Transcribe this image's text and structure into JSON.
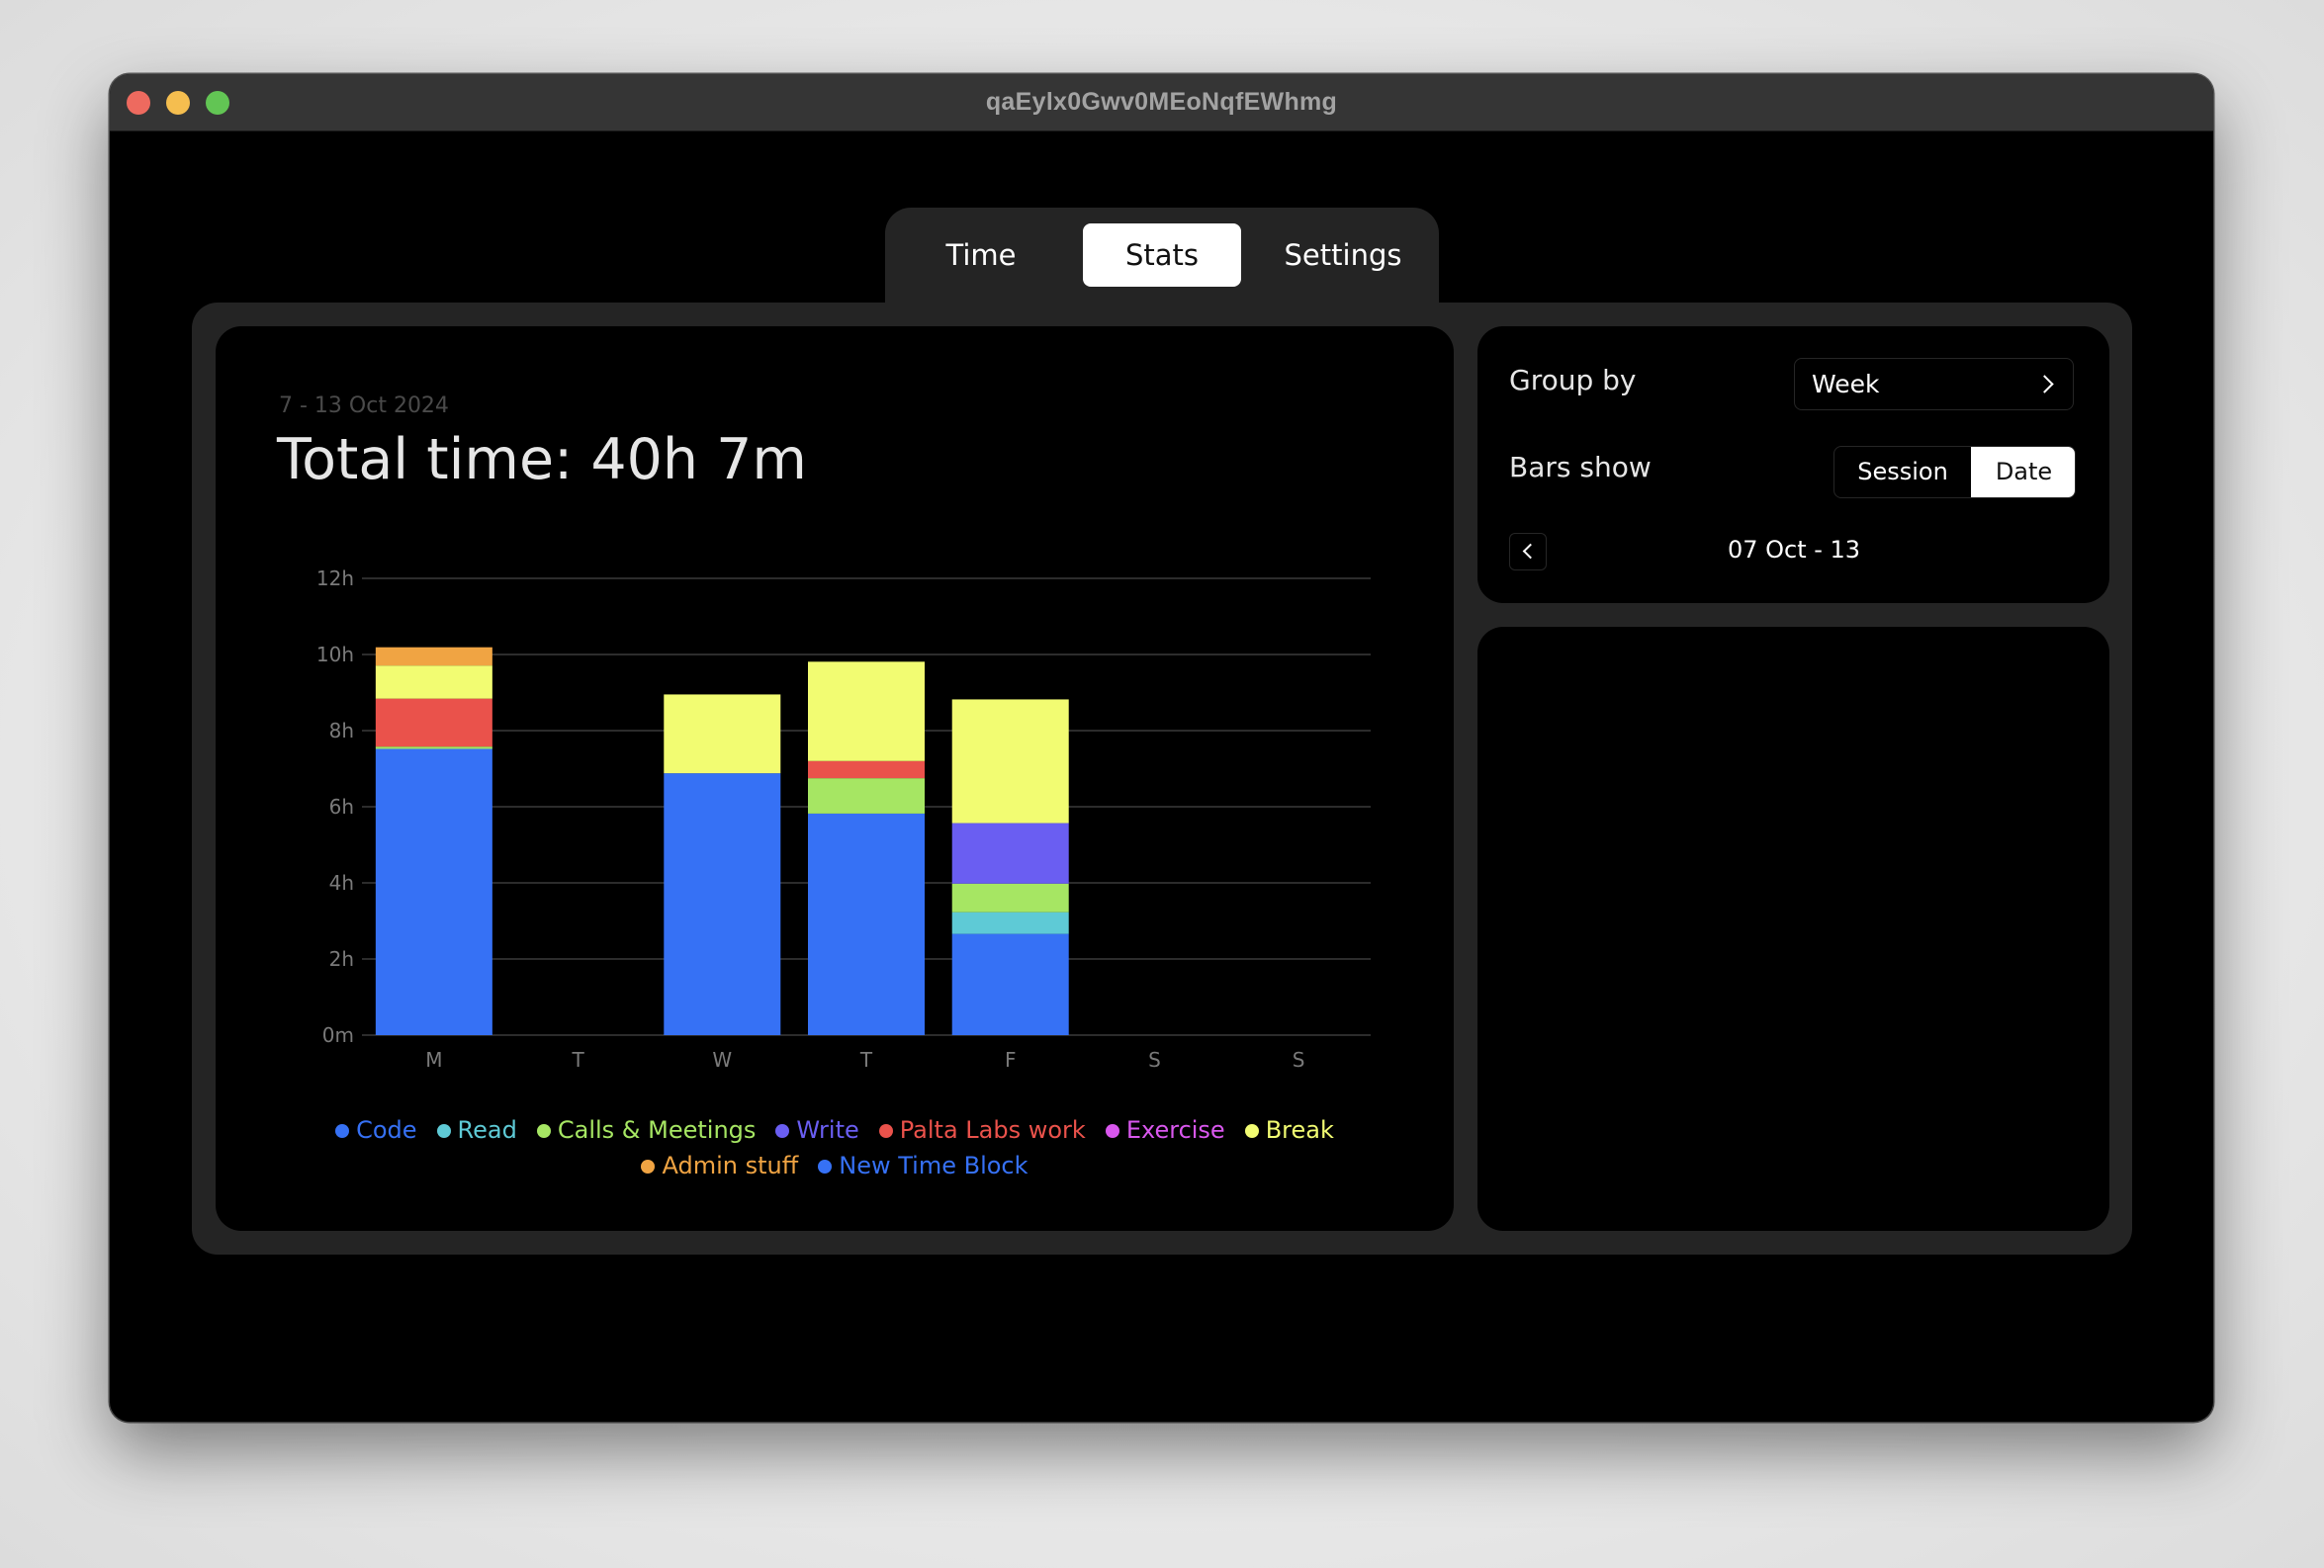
{
  "window": {
    "title": "qaEylx0Gwv0MEoNqfEWhmg",
    "controls": [
      "close",
      "minimize",
      "zoom"
    ]
  },
  "tabs": [
    {
      "label": "Time",
      "active": false
    },
    {
      "label": "Stats",
      "active": true
    },
    {
      "label": "Settings",
      "active": false
    }
  ],
  "summary": {
    "range_label": "7 - 13 Oct 2024",
    "total_label": "Total time: 40h 7m"
  },
  "controls": {
    "group_by_label": "Group by",
    "group_by_value": "Week",
    "bars_show_label": "Bars show",
    "bars_show_options": [
      "Session",
      "Date"
    ],
    "bars_show_selected": "Date",
    "period_label": "07 Oct - 13",
    "back_icon": "chevron-left-icon",
    "dropdown_icon": "chevron-right-icon"
  },
  "chart_data": {
    "type": "bar",
    "stacked": true,
    "title": "",
    "xlabel": "",
    "ylabel": "",
    "categories": [
      "M",
      "T",
      "W",
      "T",
      "F",
      "S",
      "S"
    ],
    "y_ticks": [
      {
        "value": 0,
        "label": "0m"
      },
      {
        "value": 2,
        "label": "2h"
      },
      {
        "value": 4,
        "label": "4h"
      },
      {
        "value": 6,
        "label": "6h"
      },
      {
        "value": 8,
        "label": "8h"
      },
      {
        "value": 10,
        "label": "10h"
      },
      {
        "value": 12,
        "label": "12h"
      }
    ],
    "ylim": [
      0,
      12
    ],
    "units": "hours",
    "grid": true,
    "legend_position": "bottom-center",
    "series": [
      {
        "name": "Code",
        "color": "#3671f5",
        "values": [
          7.52,
          0,
          6.88,
          5.82,
          2.66,
          0,
          0
        ]
      },
      {
        "name": "Read",
        "color": "#5ecad6",
        "values": [
          0,
          0,
          0,
          0,
          0.57,
          0,
          0
        ]
      },
      {
        "name": "Calls & Meetings",
        "color": "#a6e663",
        "values": [
          0.06,
          0,
          0,
          0.93,
          0.75,
          0,
          0
        ]
      },
      {
        "name": "Write",
        "color": "#6a5ef2",
        "values": [
          0,
          0,
          0,
          0,
          1.59,
          0,
          0
        ]
      },
      {
        "name": "Palta Labs work",
        "color": "#ea524b",
        "values": [
          1.26,
          0,
          0,
          0.45,
          0,
          0,
          0
        ]
      },
      {
        "name": "Exercise",
        "color": "#d957ee",
        "values": [
          0,
          0,
          0,
          0,
          0,
          0,
          0
        ]
      },
      {
        "name": "Break",
        "color": "#f2fc72",
        "values": [
          0.87,
          0,
          2.07,
          2.61,
          3.25,
          0,
          0
        ]
      },
      {
        "name": "Admin stuff",
        "color": "#f0a443",
        "values": [
          0.48,
          0,
          0,
          0,
          0,
          0,
          0
        ]
      },
      {
        "name": "New Time Block",
        "color": "#3671f5",
        "values": [
          0,
          0,
          0,
          0,
          0,
          0,
          0
        ]
      }
    ]
  }
}
